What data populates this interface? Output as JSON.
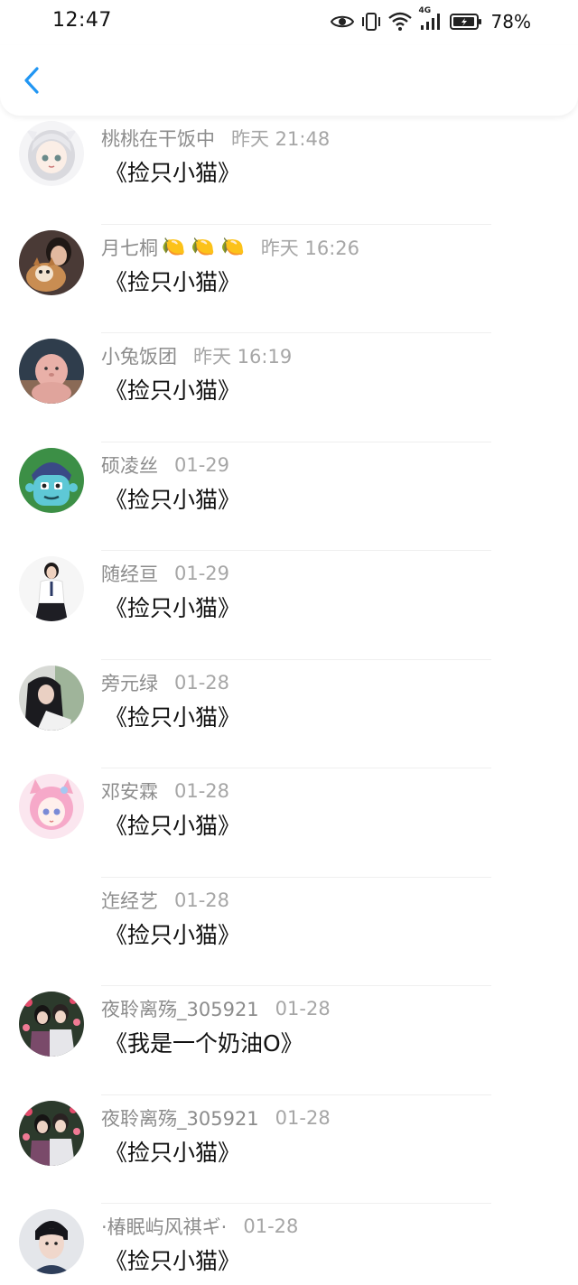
{
  "status_bar": {
    "time": "12:47",
    "network_label": "4G",
    "battery": "78%",
    "icons": [
      "eye-icon",
      "vibrate-icon",
      "wifi-icon",
      "signal-icon",
      "battery-icon"
    ]
  },
  "nav": {
    "back_icon": "chevron-left-icon",
    "accent_color": "#2196f3"
  },
  "comments": [
    {
      "name": "桃桃在干饭中",
      "emoji": "",
      "time": "昨天 21:48",
      "text": "《捡只小猫》",
      "avatar": "anime-girl-white-hair"
    },
    {
      "name": "月七桐",
      "emoji": "🍋 🍋 🍋",
      "time": "昨天 16:26",
      "text": "《捡只小猫》",
      "avatar": "photo-girl-with-dog"
    },
    {
      "name": "小兔饭团",
      "emoji": "",
      "time": "昨天 16:19",
      "text": "《捡只小猫》",
      "avatar": "pink-plush-toy"
    },
    {
      "name": "硕凌丝",
      "emoji": "",
      "time": "01-29",
      "text": "《捡只小猫》",
      "avatar": "cartoon-monster"
    },
    {
      "name": "随经亘",
      "emoji": "",
      "time": "01-29",
      "text": "《捡只小猫》",
      "avatar": "photo-student-uniform"
    },
    {
      "name": "旁元绿",
      "emoji": "",
      "time": "01-28",
      "text": "《捡只小猫》",
      "avatar": "photo-dark-hair-girl"
    },
    {
      "name": "邓安霖",
      "emoji": "",
      "time": "01-28",
      "text": "《捡只小猫》",
      "avatar": "anime-pink-cat-girl"
    },
    {
      "name": "迮经艺",
      "emoji": "",
      "time": "01-28",
      "text": "《捡只小猫》",
      "avatar": ""
    },
    {
      "name": "夜聆离殇_305921",
      "emoji": "",
      "time": "01-28",
      "text": "《我是一个奶油O》",
      "avatar": "photo-couple-hearts"
    },
    {
      "name": "夜聆离殇_305921",
      "emoji": "",
      "time": "01-28",
      "text": "《捡只小猫》",
      "avatar": "photo-couple-hearts"
    },
    {
      "name": "·椿眠屿风祺ギ·",
      "emoji": "",
      "time": "01-28",
      "text": "《捡只小猫》",
      "avatar": "photo-boy-portrait"
    }
  ]
}
